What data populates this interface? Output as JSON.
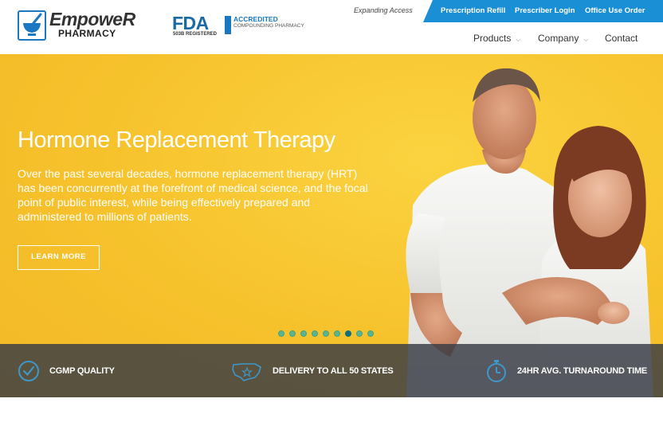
{
  "header": {
    "logo_word": "EmpoweR",
    "logo_sub": "PHARMACY",
    "fda_big": "FDA",
    "fda_small": "503B REGISTERED",
    "pcab_line1": "ACCREDITED",
    "pcab_line2": "COMPOUNDING PHARMACY",
    "expanding_access": "Expanding Access",
    "top_links": [
      "Prescription Refill",
      "Prescriber Login",
      "Office Use Order"
    ],
    "nav": [
      "Products",
      "Company",
      "Contact"
    ]
  },
  "hero": {
    "title": "Hormone Replacement Therapy",
    "body": "Over the past several decades, hormone replacement therapy (HRT) has been concurrently at the forefront of medical science, and the focal point of public interest, while being effectively prepared and administered to millions of patients.",
    "button": "LEARN MORE",
    "slide_count": 9,
    "active_slide": 6
  },
  "features": [
    {
      "label": "CGMP QUALITY",
      "icon": "check-circle-icon"
    },
    {
      "label": "DELIVERY TO ALL 50 STATES",
      "icon": "usa-map-icon"
    },
    {
      "label": "24HR AVG. TURNAROUND TIME",
      "icon": "stopwatch-icon"
    }
  ],
  "colors": {
    "accent_blue": "#1a8fd6",
    "hero_yellow": "#f7c42e",
    "feature_bar": "#373a44"
  }
}
